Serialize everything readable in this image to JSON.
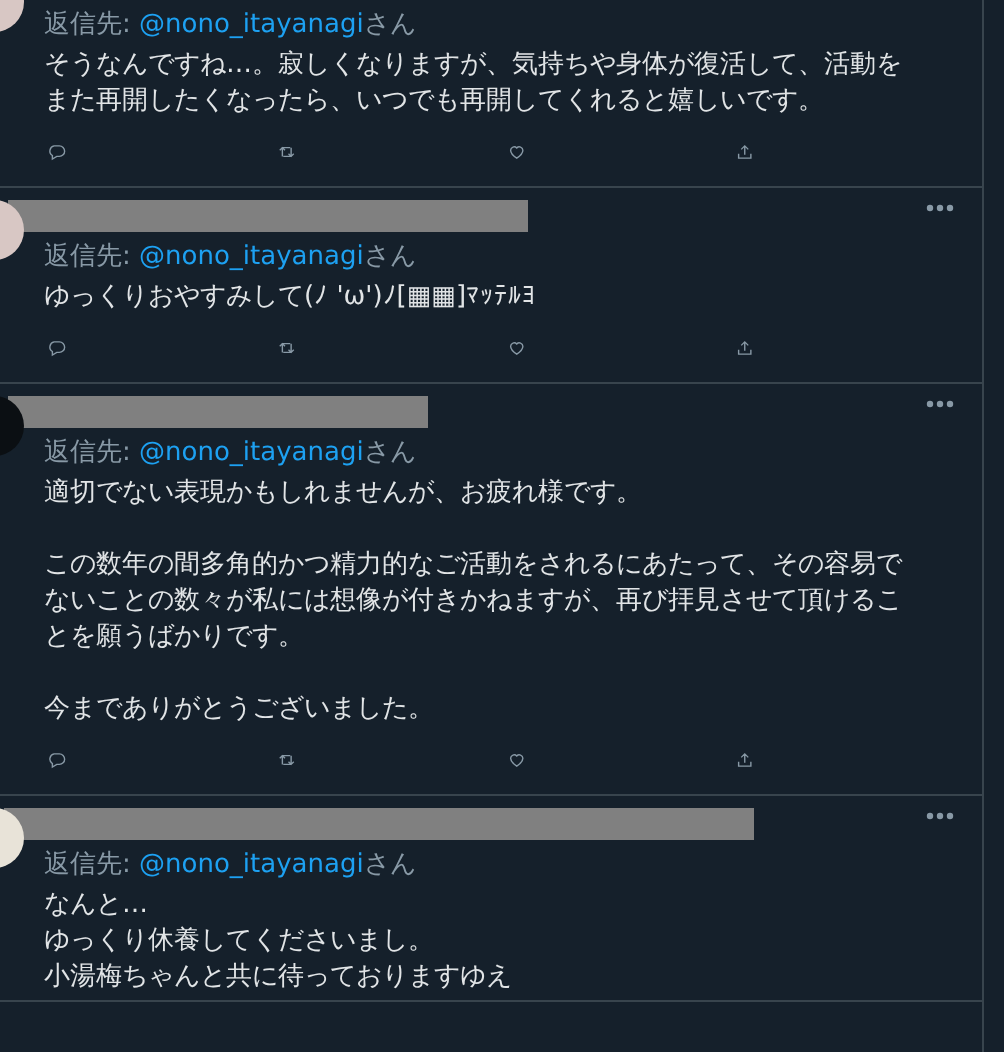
{
  "tweets": [
    {
      "name_redacted": false,
      "menu": false,
      "reply_prefix": "返信先: ",
      "reply_handle": "@nono_itayanagi",
      "reply_suffix": "さん",
      "paragraphs": [
        "そうなんですね…。寂しくなりますが、気持ちや身体が復活して、活動をまた再開したくなったら、いつでも再開してくれると嬉しいです。"
      ],
      "actions": true
    },
    {
      "name_redacted": true,
      "menu": true,
      "reply_prefix": "返信先: ",
      "reply_handle": "@nono_itayanagi",
      "reply_suffix": "さん",
      "paragraphs": [
        "ゆっくりおやすみして(ﾉ 'ω')ﾉ[▦▦]ﾏｯﾃﾙﾖ"
      ],
      "actions": true
    },
    {
      "name_redacted": true,
      "menu": true,
      "reply_prefix": "返信先: ",
      "reply_handle": "@nono_itayanagi",
      "reply_suffix": "さん",
      "paragraphs": [
        "適切でない表現かもしれませんが、お疲れ様です。",
        "この数年の間多角的かつ精力的なご活動をされるにあたって、その容易でないことの数々が私には想像が付きかねますが、再び拝見させて頂けることを願うばかりです。",
        "今までありがとうございました。"
      ],
      "actions": true
    },
    {
      "name_redacted": true,
      "menu": true,
      "reply_prefix": "返信先: ",
      "reply_handle": "@nono_itayanagi",
      "reply_suffix": "さん",
      "lines": [
        "なんと…",
        "ゆっくり休養してくださいまし。",
        "小湯梅ちゃんと共に待っておりますゆえ"
      ],
      "actions": false
    }
  ]
}
